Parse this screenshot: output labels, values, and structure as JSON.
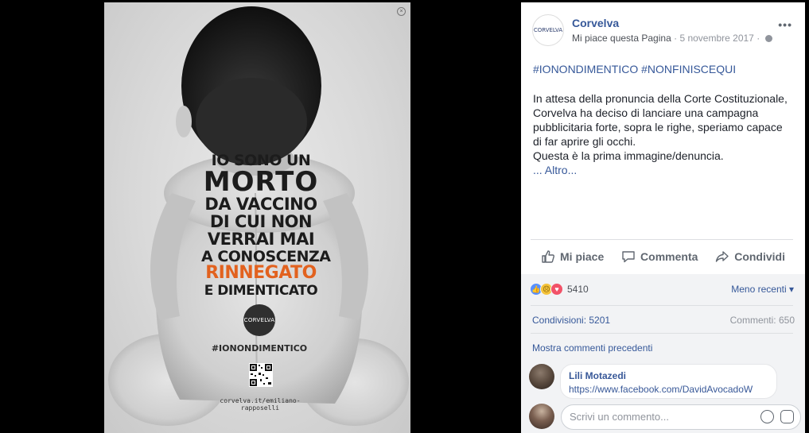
{
  "poster": {
    "headline": [
      "IO SONO UN",
      "MORTO",
      "DA VACCINO",
      "DI CUI NON",
      "VERRAI MAI",
      "A CONOSCENZA",
      "RINNEGATO",
      "E DIMENTICATO"
    ],
    "logo_text": "CORVELVA",
    "hashtag": "#IONONDIMENTICO",
    "url": "corvelva.it/emiliano-rapposelli",
    "accent_color": "#e2621f"
  },
  "post": {
    "page_name": "Corvelva",
    "avatar_text": "CORVELVA",
    "like_page": "Mi piace questa Pagina",
    "separator": "·",
    "date": "5 novembre 2017",
    "privacy_icon": "globe-icon",
    "more_icon": "ellipsis-icon",
    "hashtags": "#IONONDIMENTICO #NONFINISCEQUI",
    "body_lines": [
      "In attesa della pronuncia della Corte Costituzionale,",
      "Corvelva ha deciso di lanciare una campagna",
      "pubblicitaria forte, sopra le righe, speriamo capace",
      "di far aprire gli occhi.",
      "Questa è la prima immagine/denuncia."
    ],
    "see_more": "... Altro..."
  },
  "actions": {
    "like": "Mi piace",
    "comment": "Commenta",
    "share": "Condividi"
  },
  "reactions": {
    "types": [
      "like",
      "sad",
      "love"
    ],
    "count": "5410",
    "sort_label": "Meno recenti"
  },
  "stats": {
    "shares": "Condivisioni: 5201",
    "comments": "Commenti: 650"
  },
  "comments": {
    "previous_label": "Mostra commenti precedenti",
    "items": [
      {
        "author": "Lili Motazedi",
        "text": "https://www.facebook.com/DavidAvocadoW"
      }
    ],
    "write_placeholder": "Scrivi un commento..."
  },
  "colors": {
    "link": "#365899",
    "panel_bg": "#ffffff",
    "comments_bg": "#f2f3f5"
  }
}
